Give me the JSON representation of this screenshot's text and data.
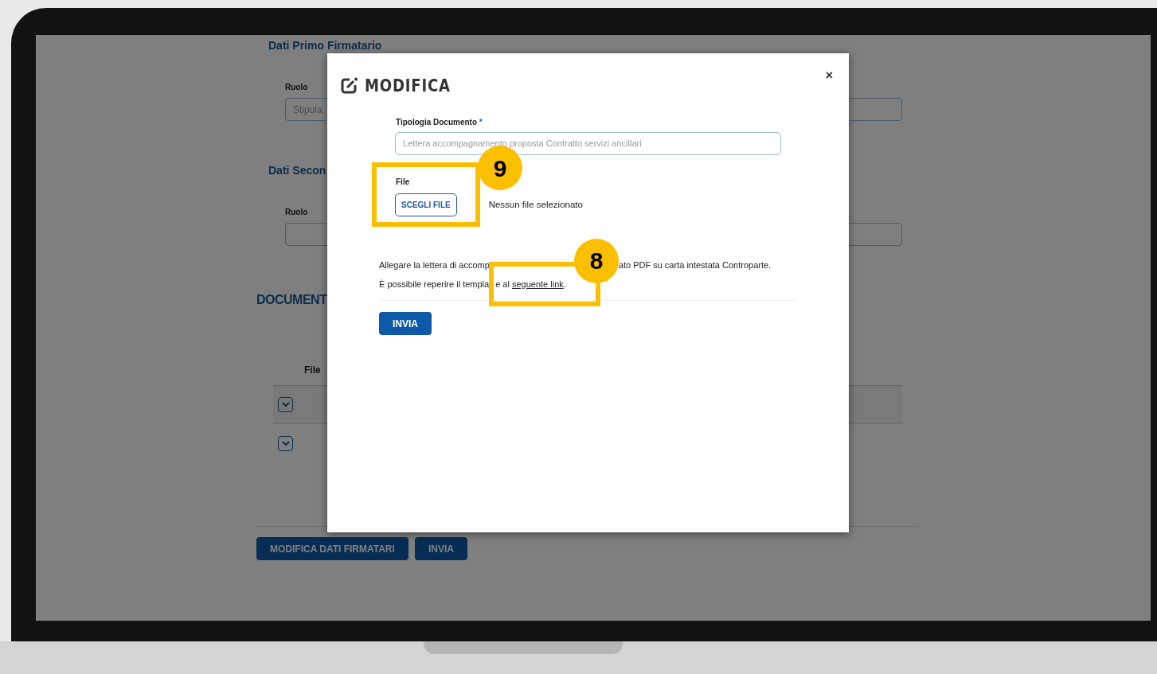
{
  "page": {
    "sections": [
      {
        "title": "Dati Primo Firmatario",
        "field_label": "Ruolo",
        "field_value": "Stipula"
      },
      {
        "title": "Dati Secon",
        "field_label": "Ruolo"
      }
    ],
    "documents": {
      "title": "DOCUMENT",
      "column": "File",
      "rows": [
        {
          "expanded": false
        },
        {
          "expanded": false
        }
      ]
    },
    "buttons": [
      "MODIFICA DATI FIRMATARI",
      "INVIA"
    ]
  },
  "modal": {
    "title": "MODIFICA",
    "close": "×",
    "type_field": {
      "label": "Tipologia Documento",
      "required": "*",
      "value": "Lettera accompagnamento proposta Contratto servizi ancillari",
      "disabled": true
    },
    "file": {
      "label": "File",
      "button": "SCEGLI FILE",
      "status": "Nessun file selezionato"
    },
    "note_line_1": [
      "Allegare la lettera di accomp",
      "ato PDF su carta intestata Controparte."
    ],
    "note_line_2": {
      "parts": [
        "È possibile reperire il templa",
        "e al "
      ],
      "link": "seguente link",
      "after": "."
    },
    "submit": "INVIA"
  },
  "annotations": [
    {
      "number": "9"
    },
    {
      "number": "8"
    }
  ]
}
